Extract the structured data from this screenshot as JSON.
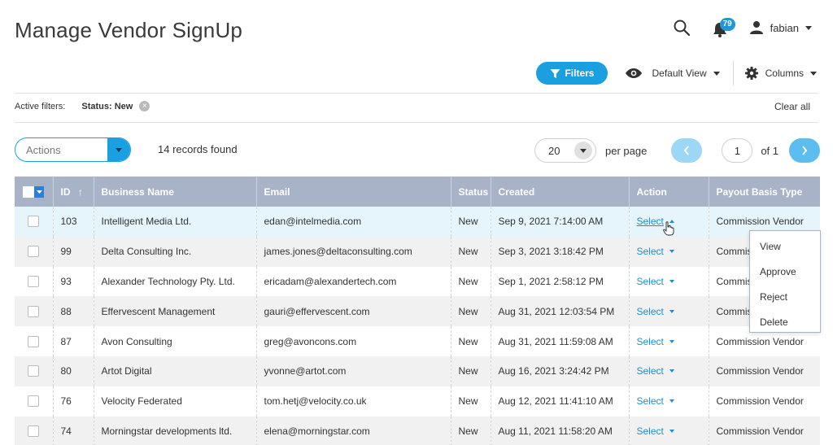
{
  "header": {
    "title": "Manage Vendor SignUp",
    "notification_count": "79",
    "user_name": "fabian"
  },
  "toolbar": {
    "filters_label": "Filters",
    "view_label": "Default View",
    "columns_label": "Columns"
  },
  "filters": {
    "active_label": "Active filters:",
    "tag": "Status: New",
    "clear_label": "Clear all"
  },
  "actions": {
    "placeholder": "Actions",
    "records_text": "14 records found"
  },
  "pager": {
    "per_page_value": "20",
    "per_page_label": "per page",
    "current_page": "1",
    "of_text": "of 1"
  },
  "table": {
    "columns": [
      "ID",
      "Business Name",
      "Email",
      "Status",
      "Created",
      "Action",
      "Payout Basis Type"
    ],
    "rows": [
      {
        "id": "103",
        "name": "Intelligent Media Ltd.",
        "email": "edan@intelmedia.com",
        "status": "New",
        "created": "Sep 9, 2021 7:14:00 AM",
        "action": "Select",
        "payout": "Commission Vendor"
      },
      {
        "id": "99",
        "name": "Delta Consulting Inc.",
        "email": "james.jones@deltaconsulting.com",
        "status": "New",
        "created": "Sep 3, 2021 3:18:42 PM",
        "action": "Select",
        "payout": "Commis"
      },
      {
        "id": "93",
        "name": "Alexander Technology Pty. Ltd.",
        "email": "ericadam@alexandertech.com",
        "status": "New",
        "created": "Sep 1, 2021 2:58:12 PM",
        "action": "Select",
        "payout": "Commis"
      },
      {
        "id": "88",
        "name": "Effervescent Management",
        "email": "gauri@effervescent.com",
        "status": "New",
        "created": "Aug 31, 2021 12:03:54 PM",
        "action": "Select",
        "payout": "Commis"
      },
      {
        "id": "87",
        "name": "Avon Consulting",
        "email": "greg@avoncons.com",
        "status": "New",
        "created": "Aug 31, 2021 11:59:08 AM",
        "action": "Select",
        "payout": "Commission Vendor"
      },
      {
        "id": "80",
        "name": "Artot Digital",
        "email": "yvonne@artot.com",
        "status": "New",
        "created": "Aug 16, 2021 3:24:42 PM",
        "action": "Select",
        "payout": "Commission Vendor"
      },
      {
        "id": "76",
        "name": "Velocity Federated",
        "email": "tom.hetj@velocity.co.uk",
        "status": "New",
        "created": "Aug 12, 2021 11:41:10 AM",
        "action": "Select",
        "payout": "Commission Vendor"
      },
      {
        "id": "74",
        "name": "Morningstar developments ltd.",
        "email": "elena@morningstar.com",
        "status": "New",
        "created": "Aug 11, 2021 11:58:20 AM",
        "action": "Select",
        "payout": "Commission Vendor"
      }
    ]
  },
  "action_menu": {
    "items": [
      "View",
      "Approve",
      "Reject",
      "Delete"
    ]
  },
  "colors": {
    "accent": "#1a9fe0",
    "header_bg": "#a9b3c8",
    "link": "#1a8fd8"
  }
}
